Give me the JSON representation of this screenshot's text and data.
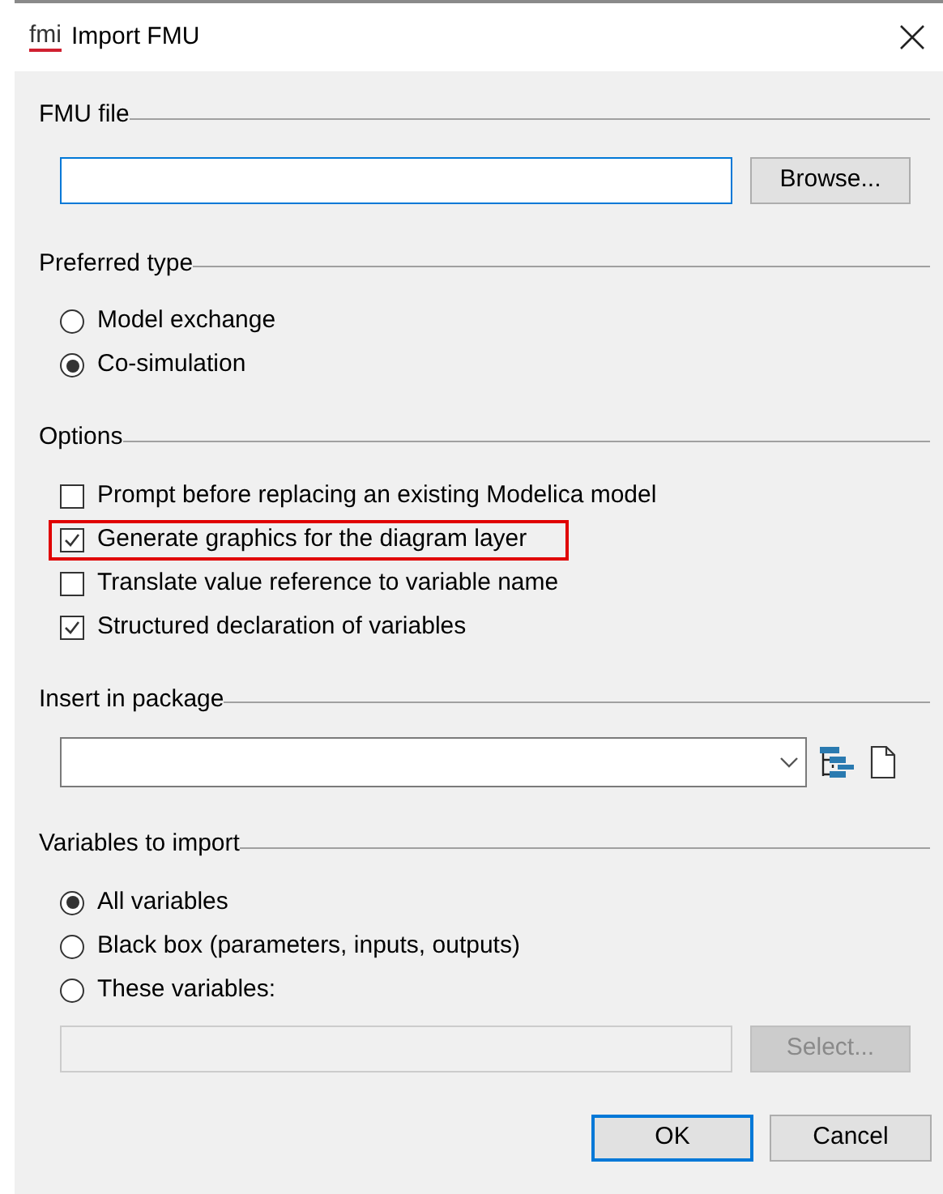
{
  "window": {
    "logo": "fmi",
    "title": "Import FMU"
  },
  "fmu_file": {
    "label": "FMU file",
    "focused": true,
    "browse_button": "Browse..."
  },
  "preferred_type": {
    "label": "Preferred type",
    "options": [
      {
        "label": "Model exchange",
        "selected": false
      },
      {
        "label": "Co-simulation",
        "selected": true
      }
    ]
  },
  "options": {
    "label": "Options",
    "items": [
      {
        "label": "Prompt before replacing an existing Modelica model",
        "checked": false,
        "highlighted": false
      },
      {
        "label": "Generate graphics for the diagram layer",
        "checked": true,
        "highlighted": true
      },
      {
        "label": "Translate value reference to variable name",
        "checked": false,
        "highlighted": false
      },
      {
        "label": "Structured declaration of variables",
        "checked": true,
        "highlighted": false
      }
    ]
  },
  "insert_in_package": {
    "label": "Insert in package"
  },
  "variables_to_import": {
    "label": "Variables to import",
    "options": [
      {
        "label": "All variables",
        "selected": true
      },
      {
        "label": "Black box (parameters, inputs, outputs)",
        "selected": false
      },
      {
        "label": "These variables:",
        "selected": false
      }
    ],
    "field_disabled": true,
    "select_button": "Select...",
    "select_disabled": true
  },
  "buttons": [
    {
      "label": "OK",
      "default": true
    },
    {
      "label": "Cancel",
      "default": false
    }
  ]
}
